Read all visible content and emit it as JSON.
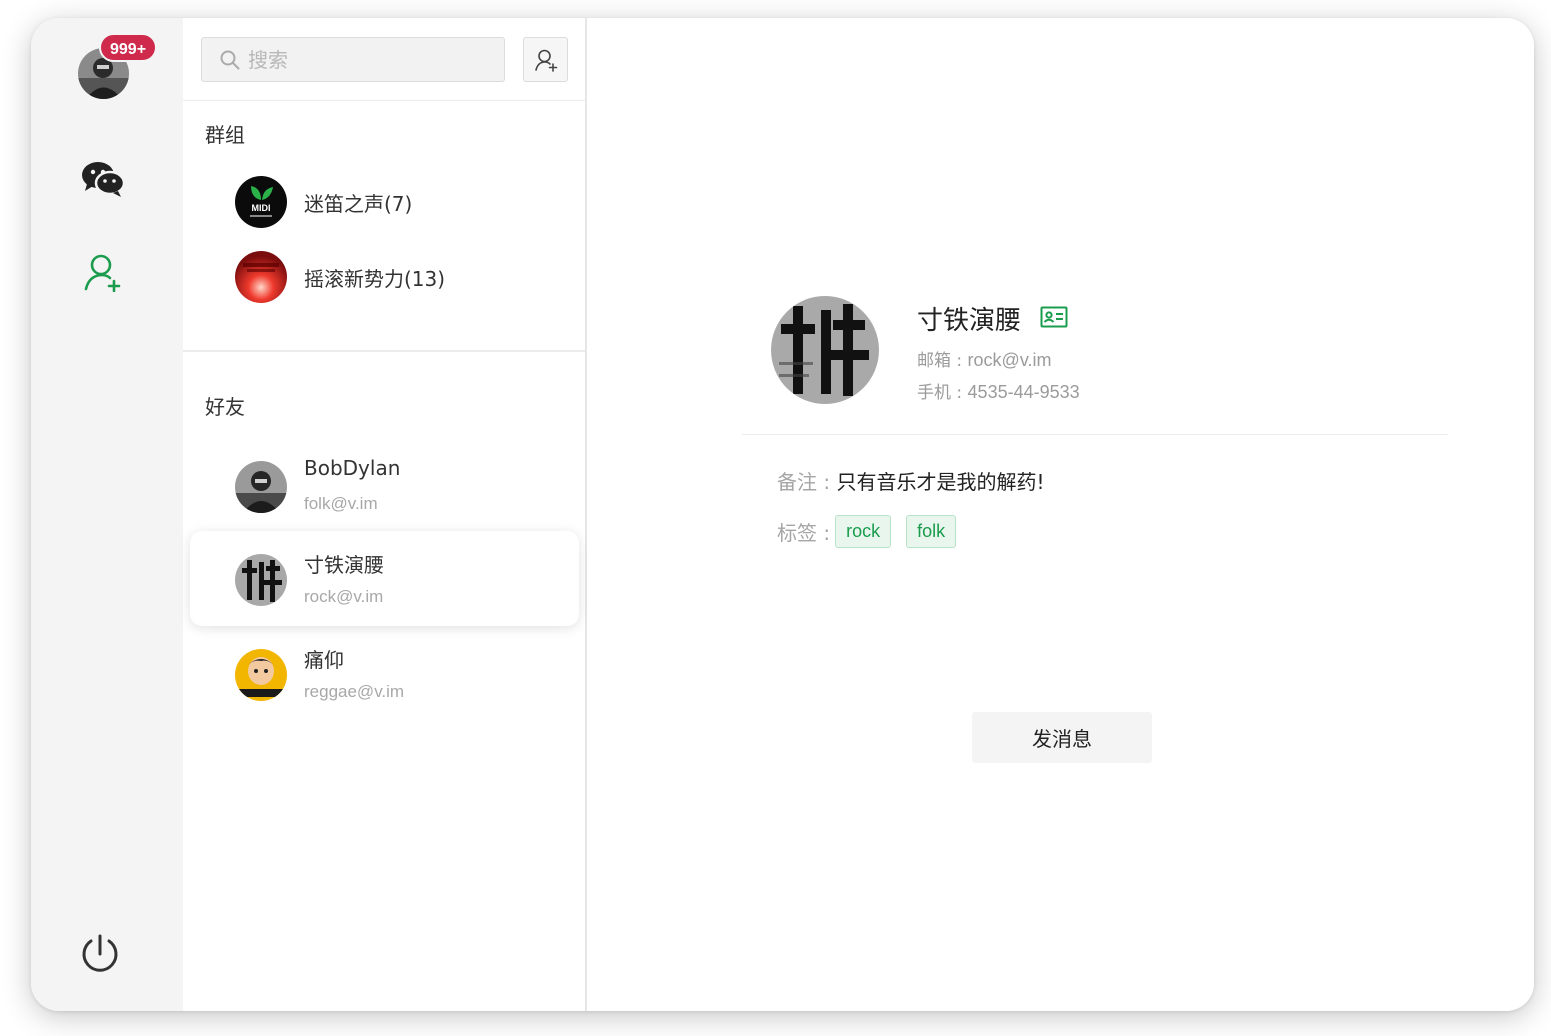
{
  "user": {
    "badge": "999+"
  },
  "search": {
    "placeholder": "搜索"
  },
  "groups": {
    "title": "群组",
    "items": [
      {
        "name": "迷笛之声(7)"
      },
      {
        "name": "摇滚新势力(13)"
      }
    ]
  },
  "friends": {
    "title": "好友",
    "items": [
      {
        "name": "BobDylan",
        "email": "folk@v.im"
      },
      {
        "name": "寸铁演腰",
        "email": "rock@v.im"
      },
      {
        "name": "痛仰",
        "email": "reggae@v.im"
      }
    ]
  },
  "detail": {
    "name": "寸铁演腰",
    "email_label": "邮箱 : ",
    "email": "rock@v.im",
    "phone_label": "手机 : ",
    "phone": "4535-44-9533",
    "remark_label": "备注 : ",
    "remark": "只有音乐才是我的解药!",
    "tags_label": "标签 : ",
    "tags": [
      "rock",
      "folk"
    ],
    "send_label": "发消息"
  },
  "colors": {
    "accent": "#1a9c4c",
    "badge": "#cf2a4c",
    "rail_bg": "#f4f4f4"
  }
}
